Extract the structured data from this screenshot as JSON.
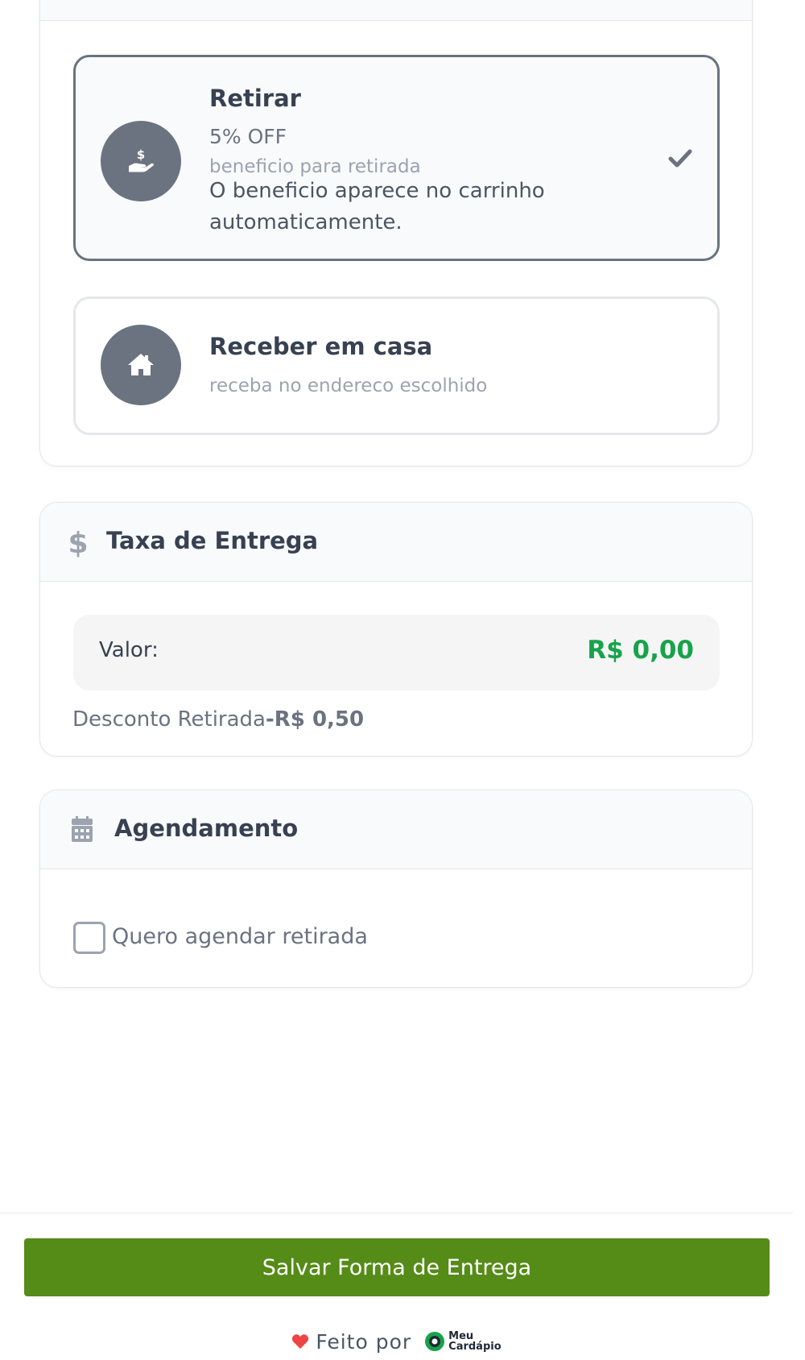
{
  "options": [
    {
      "title": "Retirar",
      "offer": "5% OFF",
      "subtitle": "beneficio para retirada",
      "description": "O beneficio aparece no carrinho automaticamente.",
      "icon": "hand-dollar-icon",
      "selected": true
    },
    {
      "title": "Receber em casa",
      "subtitle": "receba no endereco escolhido",
      "icon": "house-icon",
      "selected": false
    }
  ],
  "fee_section": {
    "title": "Taxa de Entrega",
    "icon": "dollar-icon",
    "value_label": "Valor:",
    "value": "R$ 0,00",
    "discount_label": "Desconto Retirada",
    "discount_value": "-R$ 0,50"
  },
  "schedule_section": {
    "title": "Agendamento",
    "icon": "calendar-icon",
    "checkbox_label": "Quero agendar retirada",
    "checked": false
  },
  "footer": {
    "save_label": "Salvar Forma de Entrega",
    "made_by": "Feito por",
    "logo_line1": "Meu",
    "logo_line2": "Cardápio"
  },
  "colors": {
    "accent_green": "#16a34a",
    "button_green": "#558b17",
    "icon_gray": "#6b7280",
    "heart": "#ef4444"
  }
}
